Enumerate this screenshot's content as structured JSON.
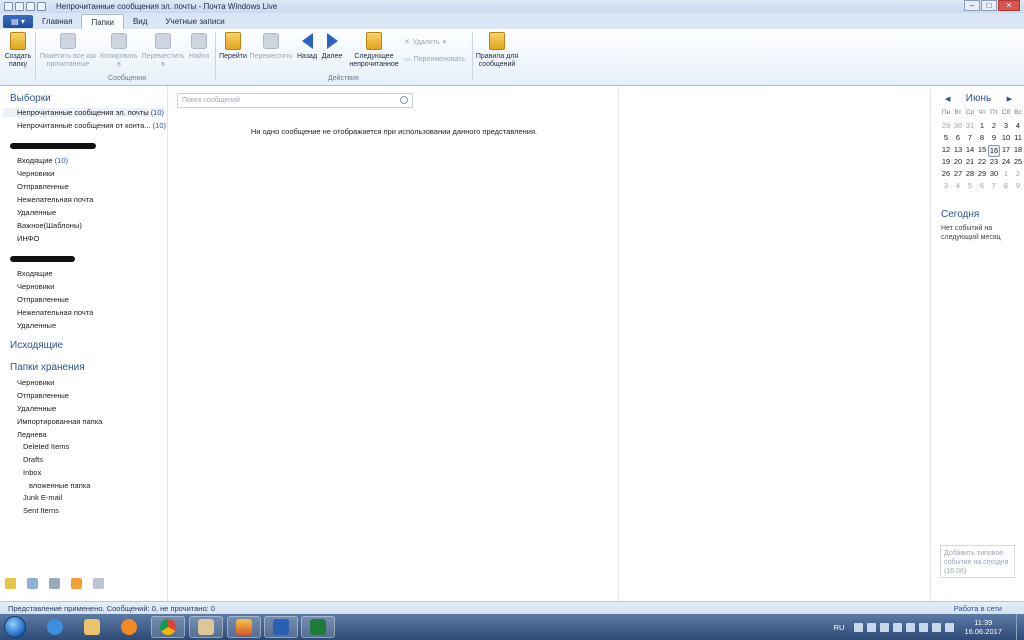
{
  "window": {
    "title": "Непрочитанные сообщения эл. почты - Почта Windows Live",
    "controls": {
      "minimize": "–",
      "maximize": "□",
      "close": "✕"
    }
  },
  "tabs": [
    {
      "label": "Главная",
      "active": false
    },
    {
      "label": "Папки",
      "active": true
    },
    {
      "label": "Вид",
      "active": false
    },
    {
      "label": "Учетные записи",
      "active": false
    }
  ],
  "ribbon": {
    "create_folder": "Создать папку",
    "mark_read": "Пометить все как прочитанные",
    "copy_to": "Копировать в",
    "move_to": "Переместить в",
    "find": "Найти",
    "group_messages": "Сообщения",
    "go": "Перейти",
    "move": "Переместить",
    "back": "Назад",
    "next": "Далее",
    "next_unread": "Следующее непрочитанное",
    "delete": "Удалить",
    "rename": "Переименовать",
    "group_actions": "Действия",
    "rules": "Правила для сообщений"
  },
  "left": {
    "views_header": "Выборки",
    "views": [
      {
        "label": "Непрочитанные сообщения эл. почты",
        "count": "(10)"
      },
      {
        "label": "Непрочитанные сообщения от конта...",
        "count": "(10)"
      }
    ],
    "account1": {
      "folders": [
        {
          "label": "Входящие",
          "count": "(10)"
        },
        {
          "label": "Черновики",
          "count": ""
        },
        {
          "label": "Отправленные",
          "count": ""
        },
        {
          "label": "Нежелательная почта",
          "count": ""
        },
        {
          "label": "Удаленные",
          "count": ""
        },
        {
          "label": "Важное(Шаблоны)",
          "count": ""
        },
        {
          "label": "ИНФО",
          "count": ""
        }
      ]
    },
    "account2": {
      "folders": [
        "Входящие",
        "Черновики",
        "Отправленные",
        "Нежелательная почта",
        "Удаленные"
      ]
    },
    "outbox_header": "Исходящие",
    "storage_header": "Папки хранения",
    "storage": [
      "Черновики",
      "Отправленные",
      "Удаленные",
      "Импортированная папка",
      "Леднева"
    ],
    "ledneva_sub": [
      "Deleted Items",
      "Drafts",
      "Inbox"
    ],
    "inbox_sub": "вложенные папка",
    "ledneva_sub2": [
      "Junk E-mail",
      "Sent Items"
    ]
  },
  "middle": {
    "search_placeholder": "Поиск сообщений",
    "empty_message": "Ни одно сообщение не отображается при использовании данного представления."
  },
  "calendar": {
    "month": "Июнь",
    "prev": "◀",
    "next": "▶",
    "weekdays": [
      "Пн",
      "Вт",
      "Ср",
      "Чт",
      "Пт",
      "Сб",
      "Вс"
    ],
    "days": [
      [
        "29",
        "30",
        "31",
        "1",
        "2",
        "3",
        "4"
      ],
      [
        "5",
        "6",
        "7",
        "8",
        "9",
        "10",
        "11"
      ],
      [
        "12",
        "13",
        "14",
        "15",
        "16",
        "17",
        "18"
      ],
      [
        "19",
        "20",
        "21",
        "22",
        "23",
        "24",
        "25"
      ],
      [
        "26",
        "27",
        "28",
        "29",
        "30",
        "1",
        "2"
      ],
      [
        "3",
        "4",
        "5",
        "6",
        "7",
        "8",
        "9"
      ]
    ],
    "today_day": "16",
    "today_header": "Сегодня",
    "no_events": "Нет событий на следующий месяц",
    "add_event": "Добавить типовое событие на сегодня (16.06)"
  },
  "status": {
    "left": "Представление применено. Сообщений: 0, не прочитано: 0",
    "right": "Работа в сети"
  },
  "taskbar": {
    "language": "RU",
    "time": "11:39",
    "date": "16.06.2017"
  },
  "colors": {
    "accent": "#2a5591",
    "ribbon_bg": "#fdfeff",
    "status_bg": "#dbe6f4"
  }
}
